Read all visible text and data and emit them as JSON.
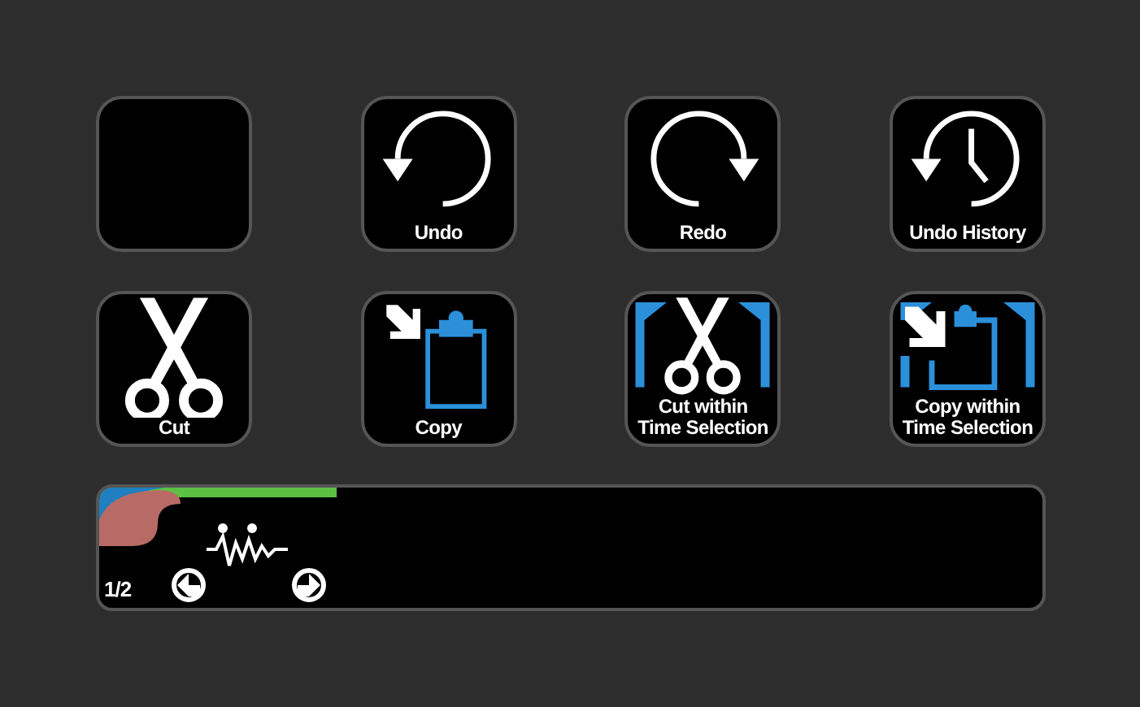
{
  "keys": [
    {
      "kind": "blank"
    },
    {
      "kind": "undo",
      "label": "Undo"
    },
    {
      "kind": "redo",
      "label": "Redo"
    },
    {
      "kind": "undo_history",
      "label": "Undo History"
    },
    {
      "kind": "cut",
      "label": "Cut"
    },
    {
      "kind": "copy",
      "label": "Copy"
    },
    {
      "kind": "cut_within",
      "label": "Cut within\nTime Selection"
    },
    {
      "kind": "copy_within",
      "label": "Copy within\nTime Selection"
    }
  ],
  "touch_strip": {
    "page": "1/2"
  }
}
